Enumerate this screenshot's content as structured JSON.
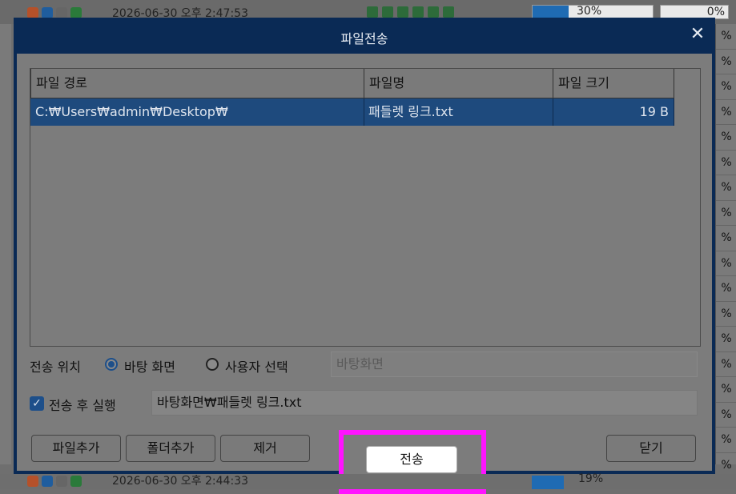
{
  "background": {
    "top_row": {
      "timestamp": "2026-06-30 오후 2:47:53",
      "progress_text": "30%",
      "progress_value": 0.3,
      "right_pct": "0%"
    },
    "bottom_row": {
      "timestamp": "2026-06-30 오후 2:44:33",
      "progress_text": "19%",
      "progress_value": 0.19
    },
    "side_pcts": [
      "%",
      "%",
      "%",
      "%",
      "%",
      "%",
      "%",
      "%",
      "%",
      "%",
      "%",
      "%",
      "%",
      "%",
      "%",
      "%",
      "%",
      "%"
    ]
  },
  "dialog": {
    "title": "파일전송",
    "close_glyph": "✕",
    "table": {
      "columns": [
        "파일 경로",
        "파일명",
        "파일 크기"
      ],
      "rows": [
        {
          "path": "C:₩Users₩admin₩Desktop₩",
          "name": "패들렛 링크.txt",
          "size": "19  B"
        }
      ]
    },
    "location": {
      "label": "전송 위치",
      "option_desktop": "바탕 화면",
      "option_user": "사용자 선택",
      "selected": "desktop",
      "path_value": "바탕화면"
    },
    "run_after": {
      "label": "전송 후 실행",
      "checked": true,
      "checkmark": "✓",
      "value": "바탕화면₩패들렛 링크.txt"
    },
    "buttons": {
      "add_file": "파일추가",
      "add_folder": "폴더추가",
      "remove": "제거",
      "send": "전송",
      "close": "닫기"
    },
    "highlight_color": "#ff14ff"
  }
}
